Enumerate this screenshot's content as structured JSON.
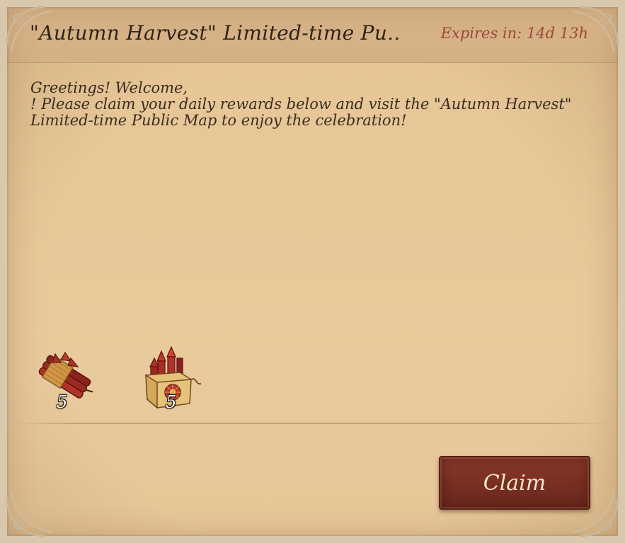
{
  "header": {
    "title": "\"Autumn Harvest\" Limited-time Pu..",
    "expires": "Expires in: 14d 13h"
  },
  "message": {
    "lines": [
      "Greetings! Welcome,",
      "! Please claim your daily rewards below and visit the \"Autumn Harvest\"",
      "Limited-time Public Map to enjoy the celebration!"
    ]
  },
  "rewards": [
    {
      "icon": "firecracker-bundle-icon",
      "quantity": "5"
    },
    {
      "icon": "firework-box-icon",
      "quantity": "5"
    }
  ],
  "actions": {
    "claim_label": "Claim"
  },
  "colors": {
    "parchment": "#e8c899",
    "header": "#d6b085",
    "expires_text": "#9a4a3a",
    "claim_button": "#7a3023"
  }
}
